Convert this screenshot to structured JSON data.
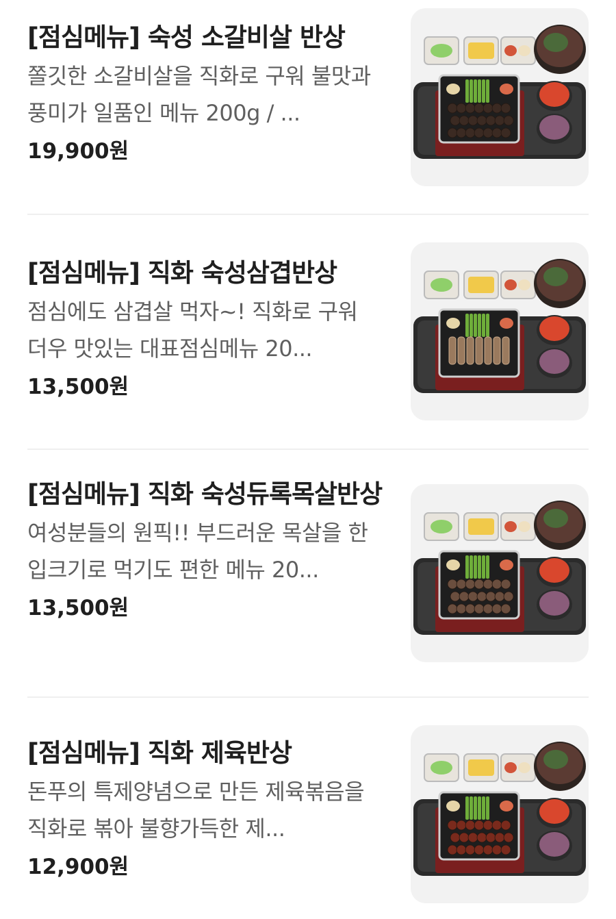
{
  "items": [
    {
      "title": "[점심메뉴] 숙성 소갈비살 반상",
      "description": "쫄깃한 소갈비살을 직화로 구워 불맛과 풍미가 일품인 메뉴 200g / ...",
      "price": "19,900원",
      "meat": "galbi",
      "image_icon": "lunch-set-photo"
    },
    {
      "title": "[점심메뉴] 직화 숙성삼겹반상",
      "description": "점심에도 삼겹살 먹자~! 직화로 구워 더우 맛있는 대표점심메뉴 20...",
      "price": "13,500원",
      "meat": "pork-belly",
      "image_icon": "lunch-set-photo"
    },
    {
      "title": "[점심메뉴] 직화 숙성듀록목살반상",
      "description": "여성분들의 원픽!! 부드러운 목살을 한입크기로 먹기도 편한 메뉴 20...",
      "price": "13,500원",
      "meat": "neck",
      "image_icon": "lunch-set-photo"
    },
    {
      "title": "[점심메뉴] 직화 제육반상",
      "description": "돈푸의 특제양념으로 만든 제육볶음을 직화로 볶아 불향가득한 제...",
      "price": "12,900원",
      "meat": "jeyuk",
      "image_icon": "lunch-set-photo"
    }
  ],
  "colors": {
    "title": "#1f1f1f",
    "description": "#5f5f5f",
    "divider": "#efefef",
    "thumb_bg": "#f2f2f2"
  }
}
